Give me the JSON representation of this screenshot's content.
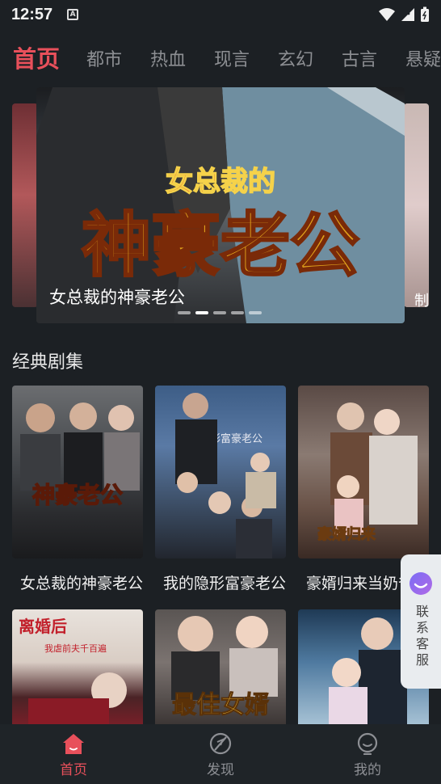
{
  "status": {
    "time": "12:57",
    "badge": "A"
  },
  "tabs": [
    "首页",
    "都市",
    "热血",
    "现言",
    "玄幻",
    "古言",
    "悬疑"
  ],
  "banner": {
    "caption": "女总裁的神豪老公",
    "poster_title_line1": "女总裁的",
    "poster_title_line2": "神豪老公",
    "next_caption_fragment": "制",
    "dots_count": 5,
    "active_dot_index": 1
  },
  "section": {
    "title": "经典剧集"
  },
  "dramas_row1": [
    {
      "title": "女总裁的神豪老公",
      "poster_text": "神豪老公"
    },
    {
      "title": "我的隐形富豪老公",
      "poster_text": "我的隐形富豪老公"
    },
    {
      "title": "豪婿归来当奶爸",
      "poster_text": "豪婿归来"
    }
  ],
  "dramas_row2": [
    {
      "poster_text": "离婚后",
      "poster_sub": "我虐前夫千百遍"
    },
    {
      "poster_text": "最佳女婿"
    },
    {
      "poster_text": ""
    }
  ],
  "service": {
    "label": "联系客服"
  },
  "nav": [
    {
      "label": "首页",
      "icon": "home-icon",
      "active": true
    },
    {
      "label": "发现",
      "icon": "discover-icon",
      "active": false
    },
    {
      "label": "我的",
      "icon": "profile-icon",
      "active": false
    }
  ],
  "colors": {
    "accent": "#e8505b",
    "background": "#1c2024",
    "nav_bg": "#1f2428"
  }
}
